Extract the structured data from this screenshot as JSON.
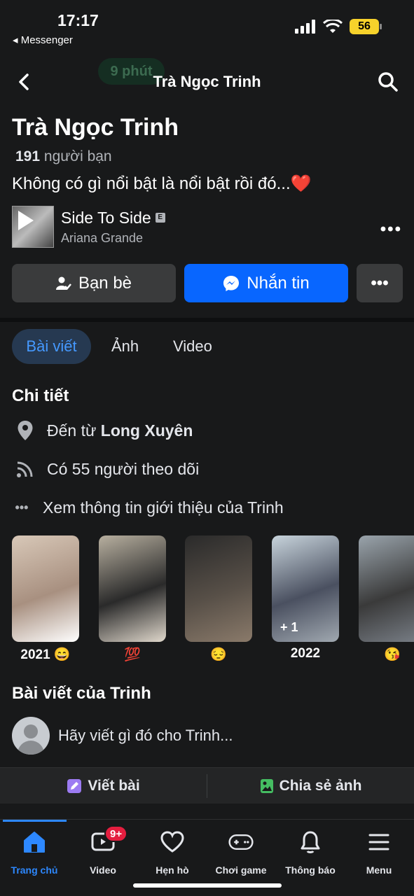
{
  "status_bar": {
    "time": "17:17",
    "back_app": "◂ Messenger",
    "battery": "56"
  },
  "ghost_bubble": "9 phút",
  "header": {
    "title": "Trà Ngọc Trinh"
  },
  "profile": {
    "name": "Trà Ngọc Trinh",
    "friends_count": "191",
    "friends_label": "người bạn",
    "bio": "Không có gì nổi bật là nổi bật rồi đó...❤️"
  },
  "music": {
    "song": "Side To Side",
    "explicit": "E",
    "artist": "Ariana Grande",
    "more": "•••"
  },
  "buttons": {
    "friends": "Bạn bè",
    "message": "Nhắn tin",
    "more": "•••"
  },
  "tabs": [
    {
      "label": "Bài viết"
    },
    {
      "label": "Ảnh"
    },
    {
      "label": "Video"
    }
  ],
  "details": {
    "title": "Chi tiết",
    "from_prefix": "Đến từ ",
    "from_place": "Long Xuyên",
    "followers": "Có 55 người theo dõi",
    "about": "Xem thông tin giới thiệu của Trinh",
    "about_icon": "•••"
  },
  "highlights": [
    {
      "caption": "2021 😄",
      "colors": [
        "#d8c8b8",
        "#a89080",
        "#ffffff"
      ]
    },
    {
      "caption": "💯",
      "colors": [
        "#b8b0a0",
        "#2a2a2a",
        "#e0d8cc"
      ]
    },
    {
      "caption": "😔",
      "colors": [
        "#2a2a2a",
        "#585048",
        "#8a7a6a"
      ]
    },
    {
      "caption": "2022",
      "colors": [
        "#c8d4dc",
        "#4a5060",
        "#a0a8b0"
      ],
      "extra": "+ 1"
    },
    {
      "caption": "😘",
      "colors": [
        "#9aa4ac",
        "#3a3a3a",
        "#7a8088"
      ]
    }
  ],
  "posts": {
    "title": "Bài viết của Trinh",
    "compose_placeholder": "Hãy viết gì đó cho Trinh...",
    "write": "Viết bài",
    "share_photo": "Chia sẻ ảnh"
  },
  "bottom_nav": [
    {
      "label": "Trang chủ",
      "icon": "home-icon"
    },
    {
      "label": "Video",
      "icon": "video-icon",
      "badge": "9+"
    },
    {
      "label": "Hẹn hò",
      "icon": "dating-heart-icon"
    },
    {
      "label": "Chơi game",
      "icon": "gamepad-icon"
    },
    {
      "label": "Thông báo",
      "icon": "bell-icon"
    },
    {
      "label": "Menu",
      "icon": "menu-icon"
    }
  ],
  "colors": {
    "accent": "#0866ff",
    "background": "#18191a",
    "surface": "#3a3b3c",
    "tab_active_bg": "#263951",
    "badge": "#e41e3f"
  }
}
